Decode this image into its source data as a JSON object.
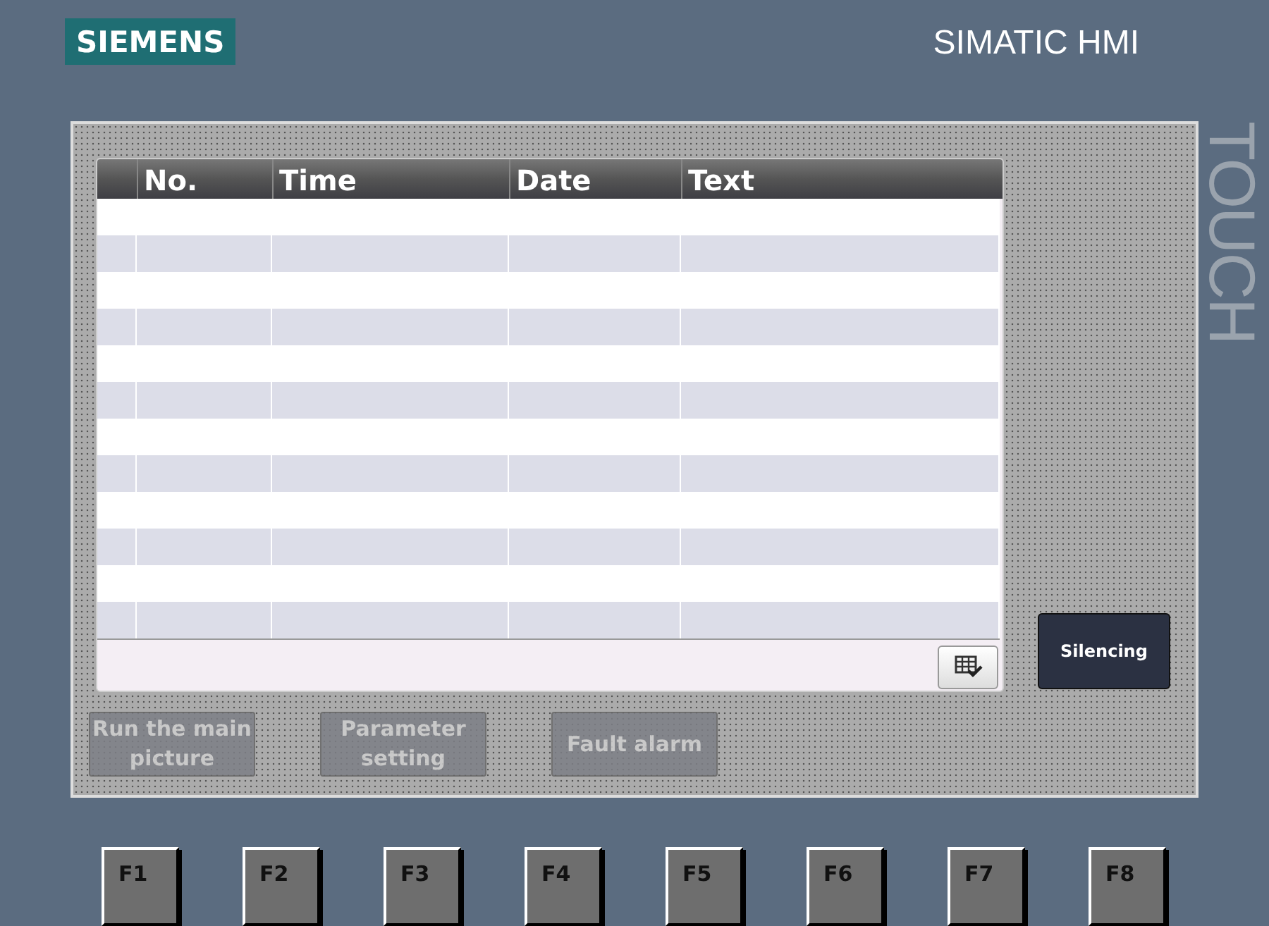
{
  "header": {
    "logo": "SIEMENS",
    "product": "SIMATIC HMI"
  },
  "side_label": "TOUCH",
  "alarm_view": {
    "columns": [
      "No.",
      "Time",
      "Date",
      "Text"
    ]
  },
  "silence_button": "Silencing",
  "screen_buttons": [
    {
      "label": "Run the main picture",
      "disabled": true
    },
    {
      "label": "Parameter setting",
      "disabled": true
    },
    {
      "label": "Fault alarm",
      "disabled": true
    }
  ],
  "function_keys": [
    "F1",
    "F2",
    "F3",
    "F4",
    "F5",
    "F6",
    "F7",
    "F8"
  ]
}
